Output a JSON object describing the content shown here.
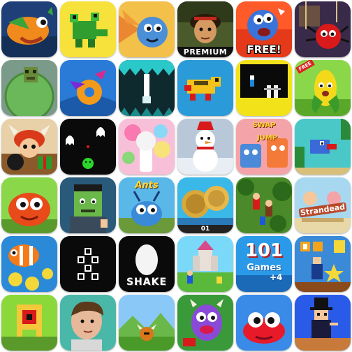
{
  "screen": {
    "background": "#ffffff",
    "layout": "6x6 app icon grid"
  },
  "apps": [
    {
      "icon": "fish-game-icon"
    },
    {
      "icon": "voxel-frog-icon"
    },
    {
      "icon": "blue-creature-icon"
    },
    {
      "icon": "adventurer-premium-icon",
      "badge": "PREMIUM"
    },
    {
      "icon": "blue-monster-icon",
      "badge": "FREE!"
    },
    {
      "icon": "spider-puzzle-icon"
    },
    {
      "icon": "green-cube-planet-icon"
    },
    {
      "icon": "flying-donut-bird-icon"
    },
    {
      "icon": "spike-maze-icon"
    },
    {
      "icon": "pixel-frog-icon"
    },
    {
      "icon": "pixel-runner-icon"
    },
    {
      "icon": "corn-character-icon",
      "badge": "FREE"
    },
    {
      "icon": "viking-bomb-icon"
    },
    {
      "icon": "ghosts-dark-icon"
    },
    {
      "icon": "candy-lollipop-icon"
    },
    {
      "icon": "snowman-icon"
    },
    {
      "icon": "swap-jump-icon",
      "title_top": "SWAP",
      "title_bottom": "JUMP"
    },
    {
      "icon": "flappy-pixel-bird-icon"
    },
    {
      "icon": "orange-blob-icon"
    },
    {
      "icon": "zombie-frankenstein-icon"
    },
    {
      "icon": "ants-blue-bug-icon",
      "title": "Ants"
    },
    {
      "icon": "coin-tiles-icon",
      "score": "01"
    },
    {
      "icon": "forest-adventure-icon"
    },
    {
      "icon": "strandead-icon",
      "title": "Strandead"
    },
    {
      "icon": "clownfish-coins-icon"
    },
    {
      "icon": "dice-dots-icon"
    },
    {
      "icon": "shake-egg-icon",
      "title": "SHAKE"
    },
    {
      "icon": "castle-rpg-icon"
    },
    {
      "icon": "101-games-icon",
      "title_num": "101",
      "title": "Games",
      "plus": "+4"
    },
    {
      "icon": "pixel-platformer-icon"
    },
    {
      "icon": "one-eye-monster-icon"
    },
    {
      "icon": "man-portrait-icon"
    },
    {
      "icon": "viking-field-icon"
    },
    {
      "icon": "purple-monster-icon"
    },
    {
      "icon": "red-crab-blob-icon"
    },
    {
      "icon": "tophat-gentleman-icon"
    }
  ]
}
